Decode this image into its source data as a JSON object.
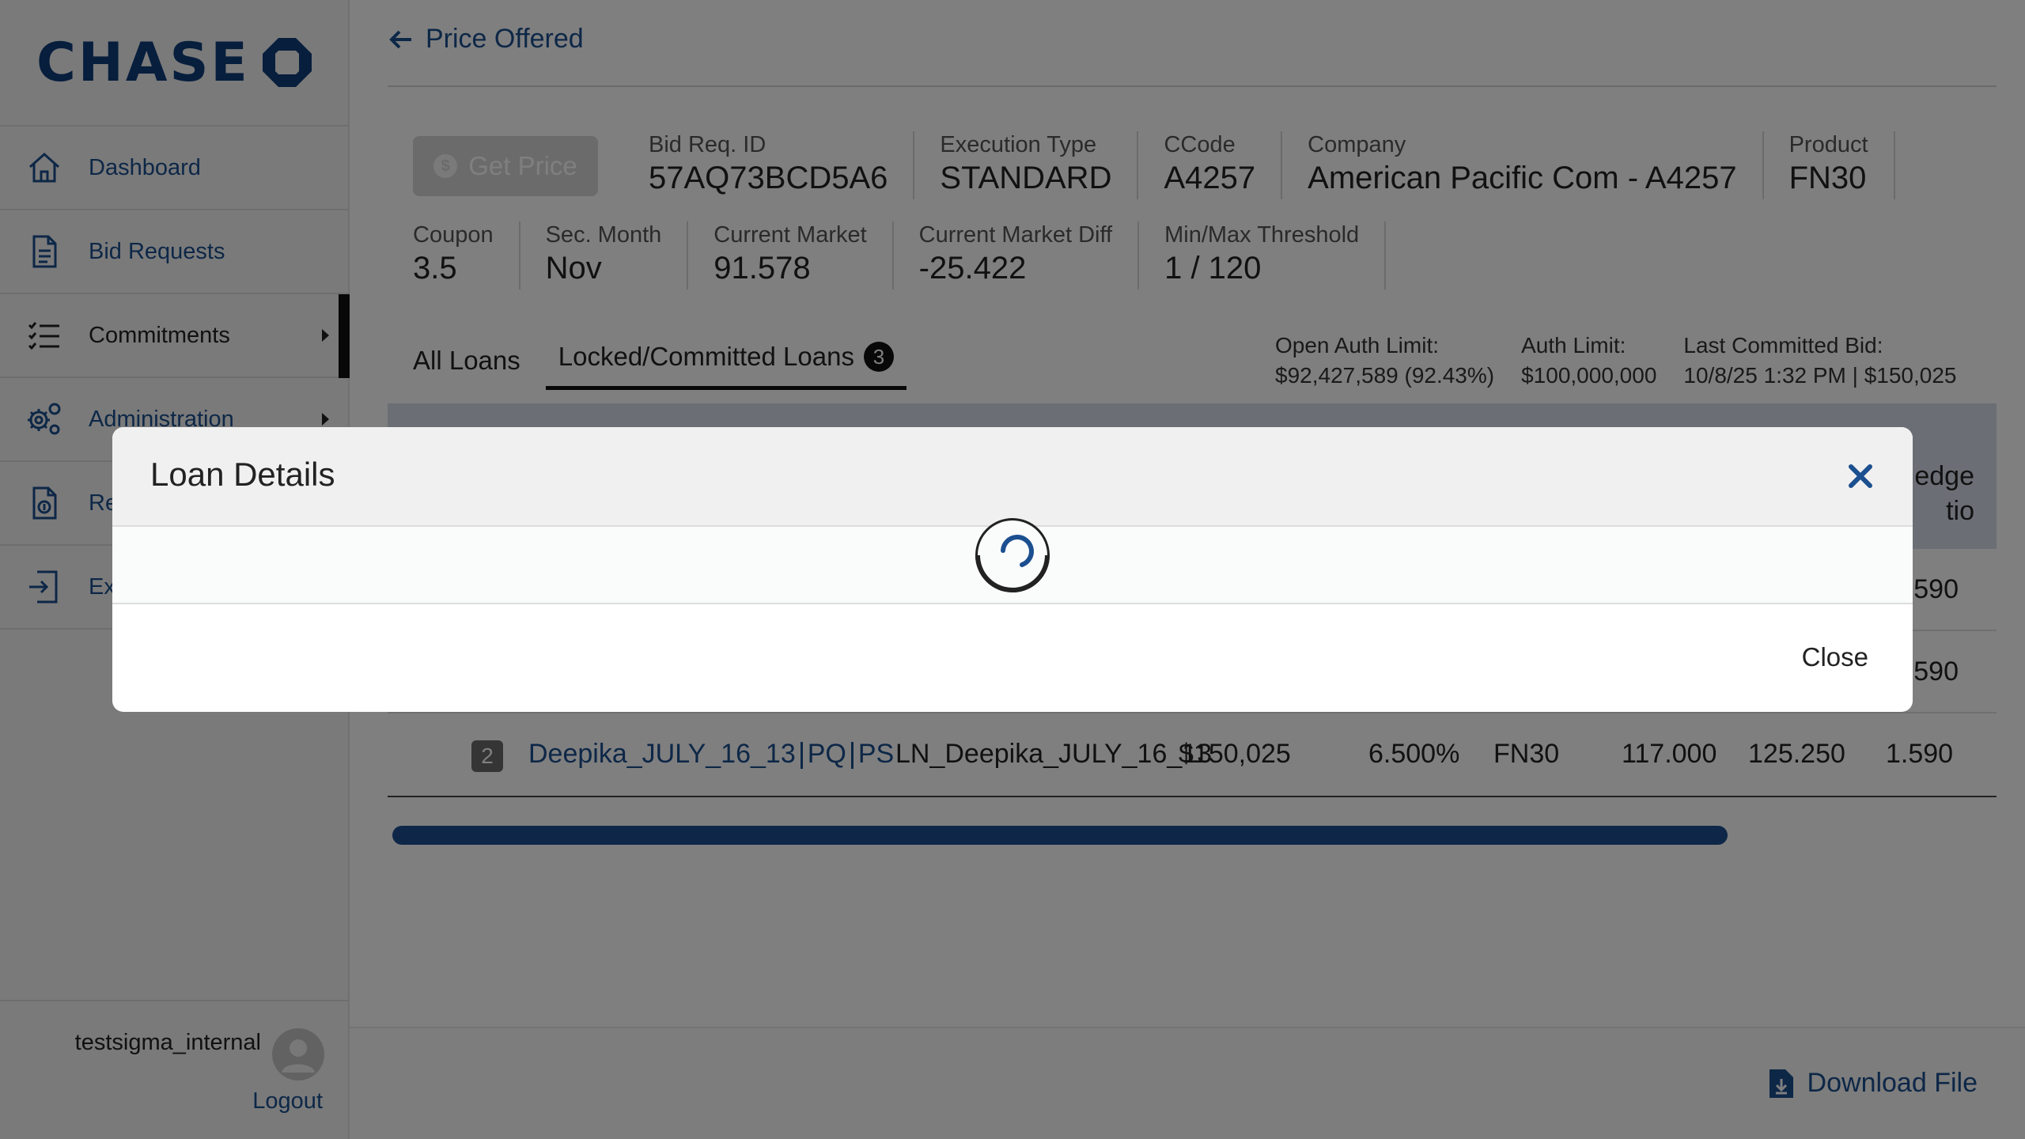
{
  "brand": {
    "name": "CHASE",
    "color": "#0f3d7a"
  },
  "sidebar": {
    "items": [
      {
        "label": "Dashboard",
        "icon": "home-icon"
      },
      {
        "label": "Bid Requests",
        "icon": "document-icon"
      },
      {
        "label": "Commitments",
        "icon": "checklist-icon"
      },
      {
        "label": "Administration",
        "icon": "gears-icon"
      },
      {
        "label": "Re",
        "icon": "report-icon"
      },
      {
        "label": "Ex",
        "icon": "export-icon"
      }
    ],
    "user": {
      "name": "testsigma_internal",
      "logout": "Logout"
    }
  },
  "header": {
    "back_label": "Price Offered"
  },
  "actions": {
    "get_price": "Get Price"
  },
  "summary": {
    "bid_req_id": {
      "label": "Bid Req. ID",
      "value": "57AQ73BCD5A6"
    },
    "execution_type": {
      "label": "Execution Type",
      "value": "STANDARD"
    },
    "ccode": {
      "label": "CCode",
      "value": "A4257"
    },
    "company": {
      "label": "Company",
      "value": "American Pacific Com - A4257"
    },
    "product": {
      "label": "Product",
      "value": "FN30"
    },
    "coupon": {
      "label": "Coupon",
      "value": "3.5"
    },
    "sec_month": {
      "label": "Sec. Month",
      "value": "Nov"
    },
    "current_market": {
      "label": "Current Market",
      "value": "91.578"
    },
    "current_market_diff": {
      "label": "Current Market Diff",
      "value": "-25.422"
    },
    "threshold": {
      "label": "Min/Max Threshold",
      "value": "1 / 120"
    }
  },
  "tabs": {
    "all": "All Loans",
    "locked": "Locked/Committed Loans",
    "locked_count": "3"
  },
  "limits": {
    "open_auth": {
      "label": "Open Auth Limit:",
      "value": "$92,427,589 (92.43%)"
    },
    "auth": {
      "label": "Auth Limit:",
      "value": "$100,000,000"
    },
    "last_bid": {
      "label": "Last Committed Bid:",
      "value": "10/8/25 1:32 PM | $150,025"
    }
  },
  "table": {
    "header_fragment_1": "edge",
    "header_fragment_2": "tio",
    "row1_fragment": "590",
    "row2_fragment": "590",
    "row3": {
      "num": "2",
      "loan": "Deepika_JULY_16_13",
      "pq": "PQ",
      "ps": "PS",
      "loan_number": "LN_Deepika_JULY_16_13",
      "amount": "$150,025",
      "rate": "6.500%",
      "product": "FN30",
      "v1": "117.000",
      "v2": "125.250",
      "v3": "1.590"
    }
  },
  "footer": {
    "download": "Download File"
  },
  "modal": {
    "title": "Loan Details",
    "close": "Close"
  }
}
